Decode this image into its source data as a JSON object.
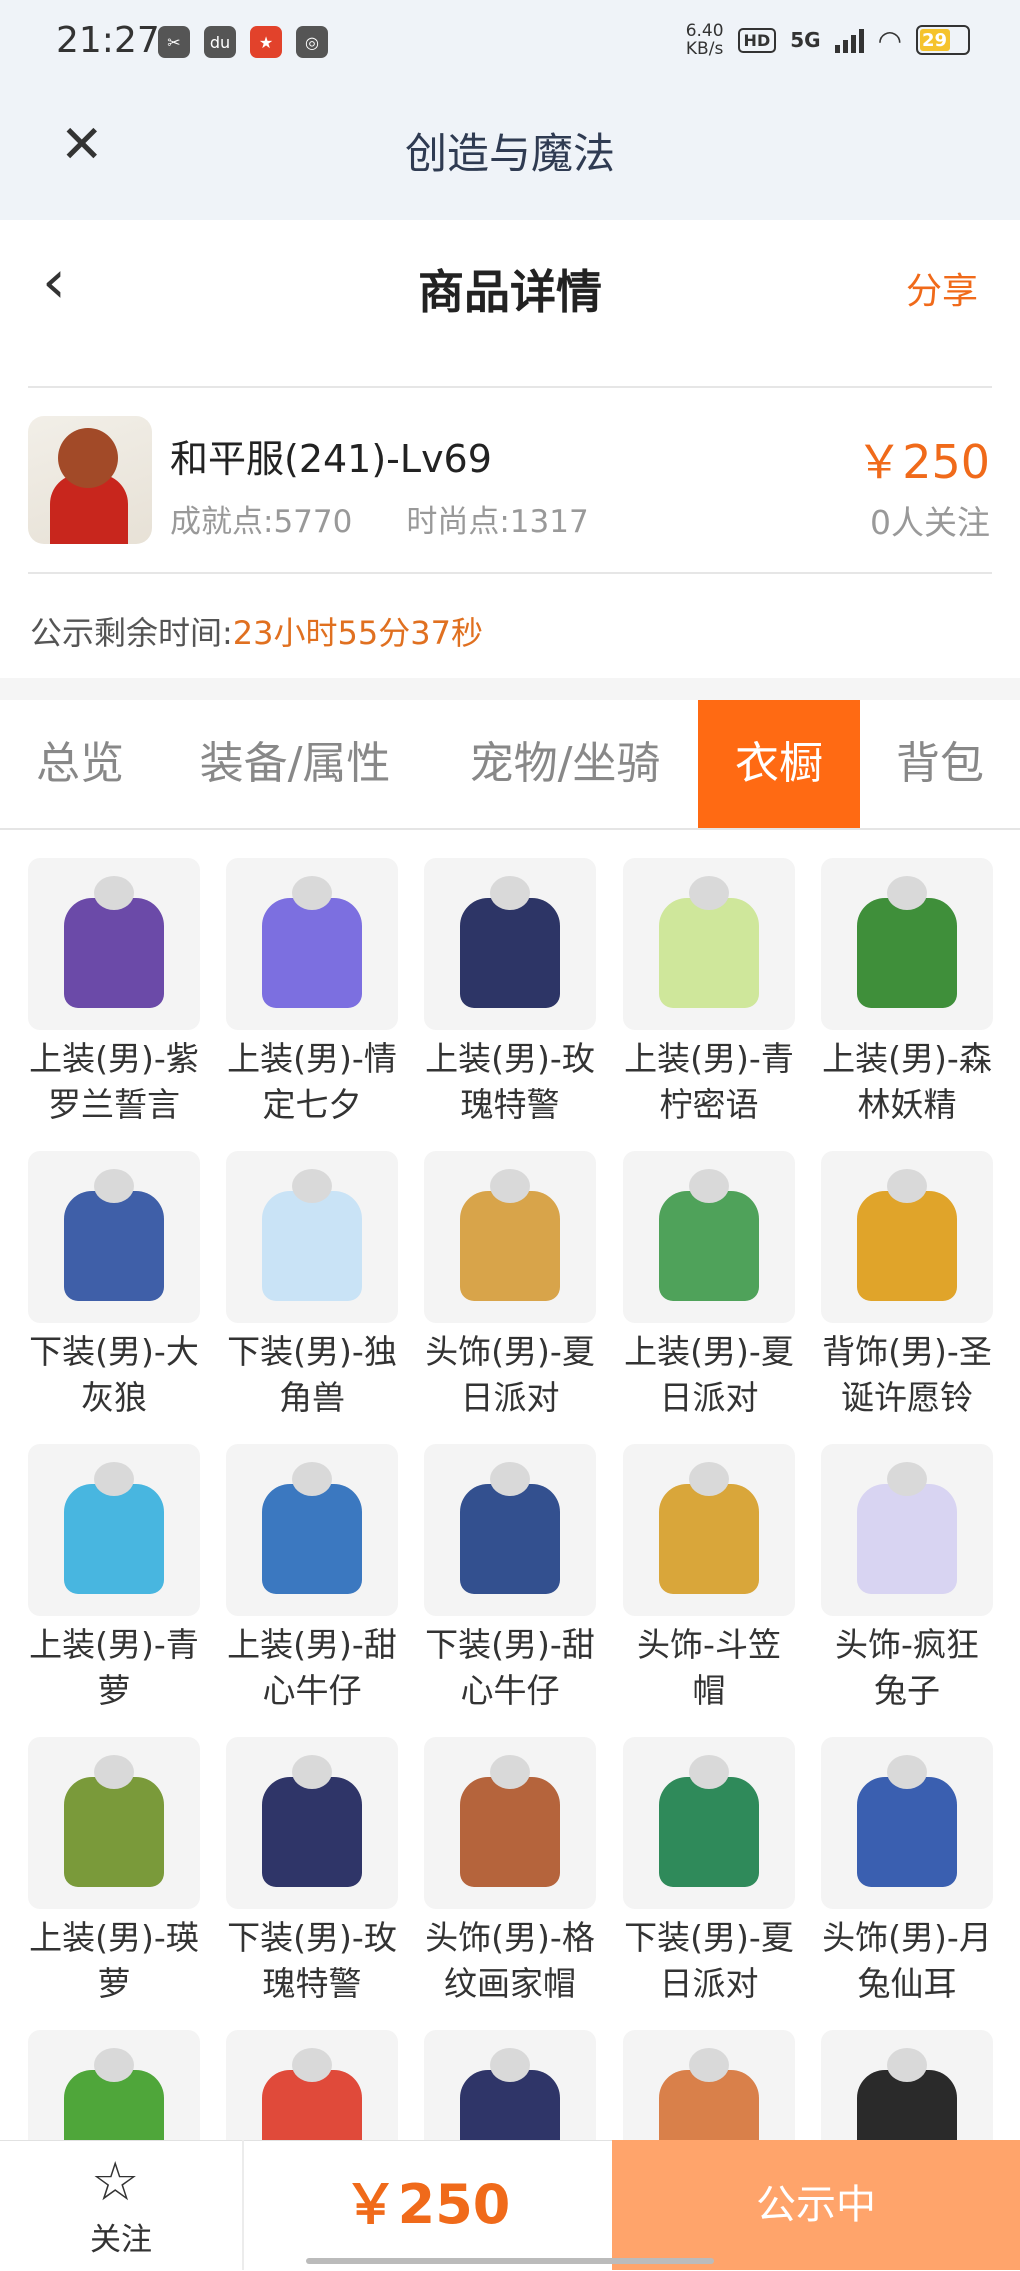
{
  "status_bar": {
    "time": "21:27",
    "apps": [
      "scissors-app",
      "du-app",
      "shopping-app",
      "ring-app"
    ],
    "speed_value": "6.40",
    "speed_unit": "KB/s",
    "hd": "HD",
    "network": "5G",
    "battery": "29"
  },
  "app_header": {
    "title": "创造与魔法"
  },
  "nav": {
    "title": "商品详情",
    "share": "分享"
  },
  "product": {
    "name": "和平服(241)-Lv69",
    "achievement": "成就点:5770",
    "fashion": "时尚点:1317",
    "price": "￥250",
    "followers": "0人关注"
  },
  "countdown": {
    "label": "公示剩余时间:",
    "value": "23小时55分37秒"
  },
  "tabs": [
    {
      "label": "总览"
    },
    {
      "label": "装备/属性"
    },
    {
      "label": "宠物/坐骑"
    },
    {
      "label": "衣橱"
    },
    {
      "label": "背包"
    }
  ],
  "active_tab": "衣橱",
  "wardrobe": [
    {
      "l1": "上装(男)-紫",
      "l2": "罗兰誓言",
      "icon": "purple-jacket-icon",
      "color": "#6b4aa8"
    },
    {
      "l1": "上装(男)-情",
      "l2": "定七夕",
      "icon": "lavender-jacket-icon",
      "color": "#7c6fe0"
    },
    {
      "l1": "上装(男)-玫",
      "l2": "瑰特警",
      "icon": "police-jacket-icon",
      "color": "#2d3566"
    },
    {
      "l1": "上装(男)-青",
      "l2": "柠密语",
      "icon": "lemon-jacket-icon",
      "color": "#cfe79b"
    },
    {
      "l1": "上装(男)-森",
      "l2": "林妖精",
      "icon": "forest-jacket-icon",
      "color": "#3f8f3a"
    },
    {
      "l1": "下装(男)-大",
      "l2": "灰狼",
      "icon": "wolf-pants-icon",
      "color": "#3f5fa8"
    },
    {
      "l1": "下装(男)-独",
      "l2": "角兽",
      "icon": "unicorn-shoes-icon",
      "color": "#c9e3f6"
    },
    {
      "l1": "头饰(男)-夏",
      "l2": "日派对",
      "icon": "party-hat-icon",
      "color": "#d8a44a"
    },
    {
      "l1": "上装(男)-夏",
      "l2": "日派对",
      "icon": "party-top-icon",
      "color": "#4fa25a"
    },
    {
      "l1": "背饰(男)-圣",
      "l2": "诞许愿铃",
      "icon": "christmas-bell-icon",
      "color": "#e0a42a"
    },
    {
      "l1": "上装(男)-青",
      "l2": "萝",
      "icon": "cyan-robe-icon",
      "color": "#48b6e0"
    },
    {
      "l1": "上装(男)-甜",
      "l2": "心牛仔",
      "icon": "denim-jacket-icon",
      "color": "#3b78c0"
    },
    {
      "l1": "下装(男)-甜",
      "l2": "心牛仔",
      "icon": "denim-pants-icon",
      "color": "#33508f"
    },
    {
      "l1": "头饰-斗笠",
      "l2": "帽",
      "icon": "straw-hat-icon",
      "color": "#d9a63a"
    },
    {
      "l1": "头饰-疯狂",
      "l2": "兔子",
      "icon": "bunny-hat-icon",
      "color": "#d8d4f2"
    },
    {
      "l1": "上装(男)-瑛",
      "l2": "萝",
      "icon": "green-vest-icon",
      "color": "#7a9a3a"
    },
    {
      "l1": "下装(男)-玫",
      "l2": "瑰特警",
      "icon": "navy-pants-icon",
      "color": "#2f3568"
    },
    {
      "l1": "头饰(男)-格",
      "l2": "纹画家帽",
      "icon": "plaid-beret-icon",
      "color": "#b5643c"
    },
    {
      "l1": "下装(男)-夏",
      "l2": "日派对",
      "icon": "green-shorts-icon",
      "color": "#2f8a5a"
    },
    {
      "l1": "头饰(男)-月",
      "l2": "兔仙耳",
      "icon": "rabbit-ears-icon",
      "color": "#3a5fb0"
    },
    {
      "l1": "",
      "l2": "",
      "icon": "green-boots-icon",
      "color": "#4fa63a"
    },
    {
      "l1": "",
      "l2": "",
      "icon": "red-hair-icon",
      "color": "#e04a3a"
    },
    {
      "l1": "",
      "l2": "",
      "icon": "dark-pants-icon",
      "color": "#2f3568"
    },
    {
      "l1": "",
      "l2": "",
      "icon": "orange-hair-icon",
      "color": "#d9804a"
    },
    {
      "l1": "",
      "l2": "",
      "icon": "goggles-hair-icon",
      "color": "#2a2a2a"
    }
  ],
  "bottom": {
    "follow": "关注",
    "price": "￥250",
    "status": "公示中"
  }
}
